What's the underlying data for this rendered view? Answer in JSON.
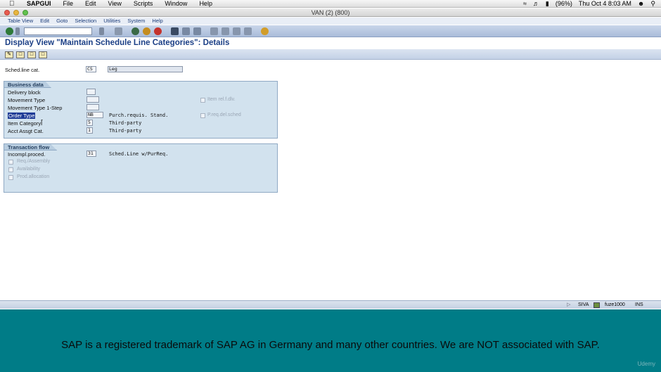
{
  "mac_menubar": {
    "app_name": "SAPGUI",
    "items": [
      "File",
      "Edit",
      "View",
      "Scripts",
      "Window",
      "Help"
    ],
    "battery": "(96%)",
    "clock": "Thu Oct 4  8:03 AM"
  },
  "window": {
    "title": "VAN (2) (800)"
  },
  "sap_menu": [
    "Table View",
    "Edit",
    "Goto",
    "Selection",
    "Utilities",
    "System",
    "Help"
  ],
  "page_title": "Display View \"Maintain Schedule Line Categories\": Details",
  "header": {
    "label": "Sched.line cat.",
    "code": "CS",
    "description": "Leg"
  },
  "business_data": {
    "title": "Business data",
    "delivery_block_label": "Delivery block",
    "movement_type_label": "Movement Type",
    "movement_type_1step_label": "Movement Type 1-Step",
    "order_type_label": "Order Type",
    "order_type_value": "NB",
    "order_type_desc": "Purch.requis. Stand.",
    "item_category_label": "Item Category",
    "item_category_value": "5",
    "item_category_desc": "Third-party",
    "acct_assgt_label": "Acct Assgt Cat.",
    "acct_assgt_value": "1",
    "acct_assgt_desc": "Third-party",
    "item_rel_dlv_label": "Item rel.f.dlv.",
    "preq_del_sched_label": "P.req.del.sched"
  },
  "transaction_flow": {
    "title": "Transaction flow",
    "incompl_label": "Incompl.proced.",
    "incompl_value": "31",
    "incompl_desc": "Sched.Line w/PurReq.",
    "req_assembly_label": "Req./Assembly",
    "availability_label": "Availability",
    "prod_allocation_label": "Prod.allocation"
  },
  "statusbar": {
    "user": "SIVA",
    "server": "fuze1000",
    "mode": "INS"
  },
  "banner": {
    "text": "SAP is a registered trademark of SAP AG in Germany and many other countries. We are NOT associated with SAP.",
    "watermark": "Udemy"
  },
  "colors": {
    "title_blue": "#1b3f86",
    "banner_teal": "#007c87",
    "group_box": "#d2e2ee"
  }
}
